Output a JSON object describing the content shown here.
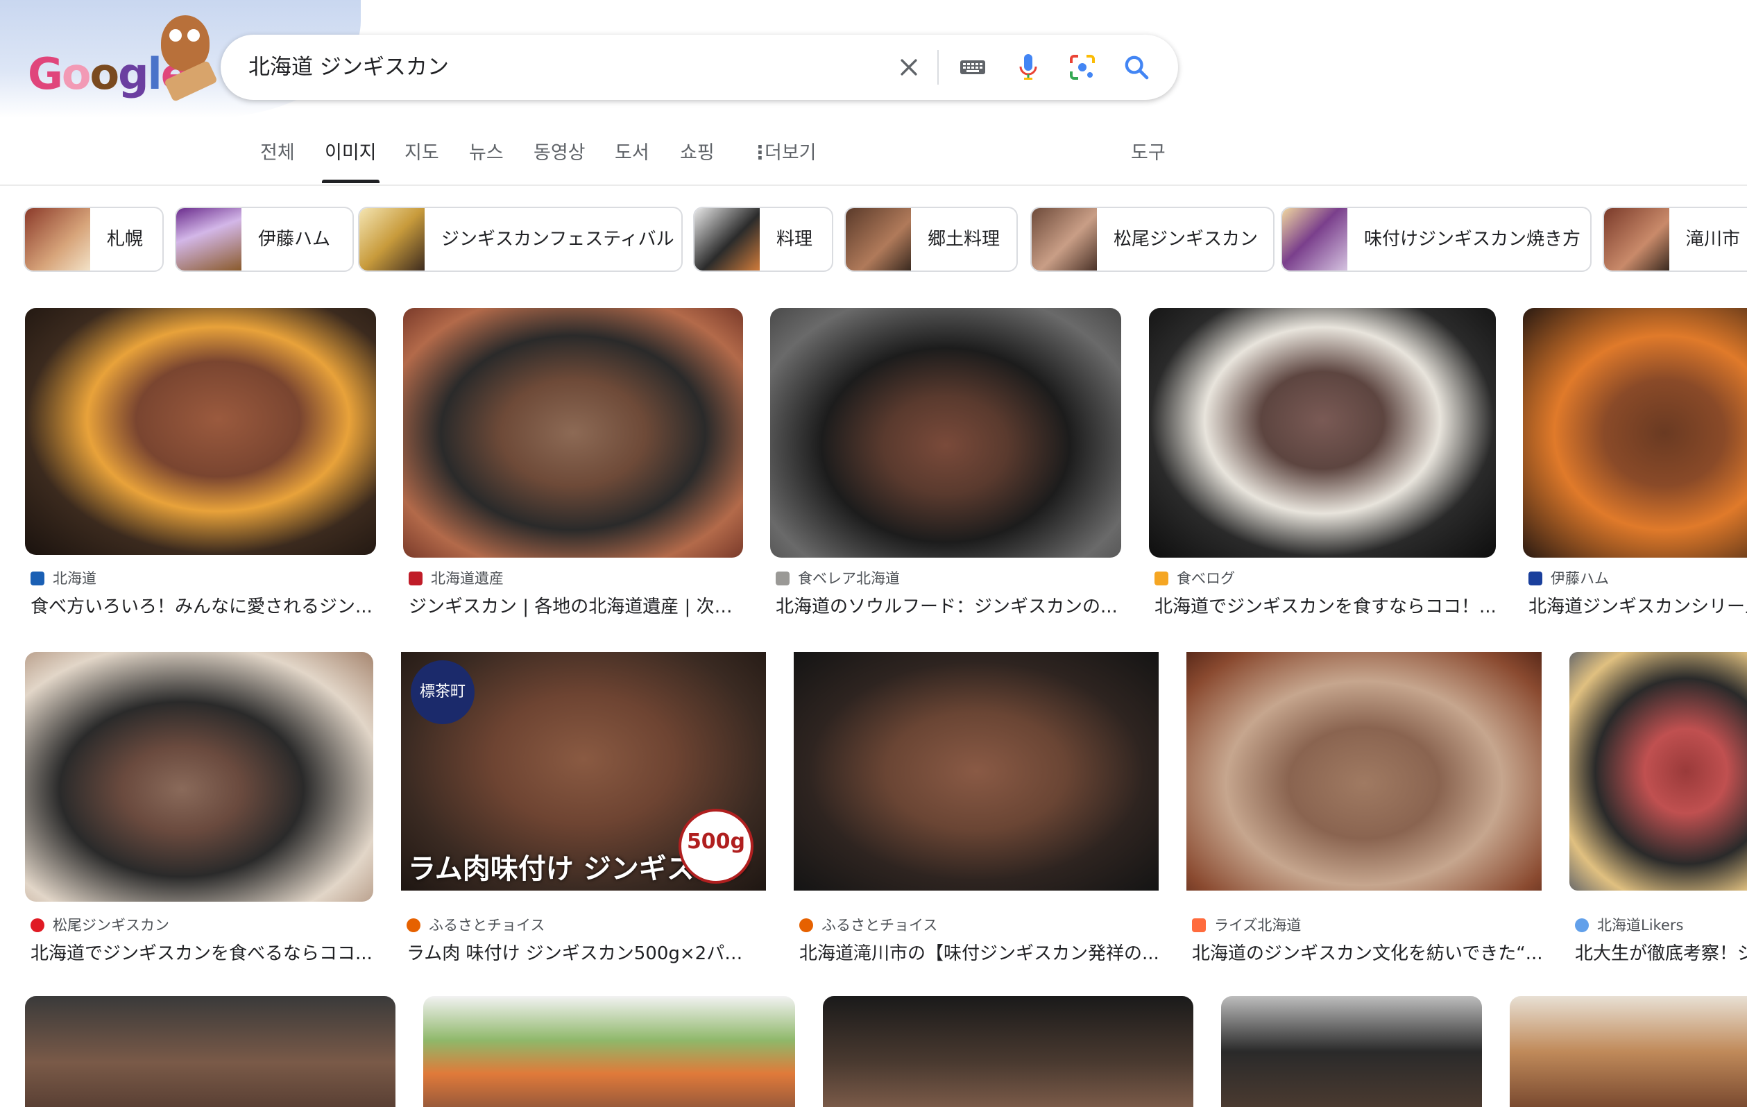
{
  "doodle": {
    "logo_letters": [
      "G",
      "o",
      "o",
      "g",
      "l",
      "e"
    ]
  },
  "search": {
    "query": "北海道 ジンギスカン",
    "icons": [
      "clear-icon",
      "keyboard-icon",
      "microphone-icon",
      "lens-icon",
      "search-icon"
    ]
  },
  "tabs": [
    {
      "label": "전체"
    },
    {
      "label": "이미지"
    },
    {
      "label": "지도"
    },
    {
      "label": "뉴스"
    },
    {
      "label": "동영상"
    },
    {
      "label": "도서"
    },
    {
      "label": "쇼핑"
    },
    {
      "label": "더보기"
    },
    {
      "label": "도구"
    }
  ],
  "chips": [
    {
      "label": "札幌"
    },
    {
      "label": "伊藤ハム"
    },
    {
      "label": "ジンギスカンフェスティバル"
    },
    {
      "label": "料理"
    },
    {
      "label": "郷土料理"
    },
    {
      "label": "松尾ジンギスカン"
    },
    {
      "label": "味付けジンギスカン焼き方"
    },
    {
      "label": "滝川市"
    }
  ],
  "results": [
    {
      "source": "北海道",
      "title": "食べ方いろいろ！みんなに愛されるジン...",
      "favicon_color": "#1a5fb4"
    },
    {
      "source": "北海道遺産",
      "title": "ジンギスカン | 各地の北海道遺産 | 次の...",
      "favicon_color": "#c01c28"
    },
    {
      "source": "食ベレア北海道",
      "title": "北海道のソウルフード：ジンギスカンの...",
      "favicon_color": "#9a9996"
    },
    {
      "source": "食べログ",
      "title": "北海道でジンギスカンを食すならココ！...",
      "favicon_color": "#f5a623"
    },
    {
      "source": "伊藤ハム",
      "title": "北海道ジンギスカンシリーズ",
      "favicon_color": "#1a3f9c"
    },
    {
      "source": "松尾ジンギスカン",
      "title": "北海道でジンギスカンを食べるならココ...",
      "favicon_color": "#e01b24"
    },
    {
      "source": "ふるさとチョイス",
      "title": "ラム肉 味付け ジンギスカン500g×2パッ...",
      "favicon_color": "#e66100"
    },
    {
      "source": "ふるさとチョイス",
      "title": "北海道滝川市の【味付ジンギスカン発祥の...",
      "favicon_color": "#e66100"
    },
    {
      "source": "ライズ北海道",
      "title": "北海道のジンギスカン文化を紡いできた“...",
      "favicon_color": "#ff6b3d"
    },
    {
      "source": "北海道Likers",
      "title": "北大生が徹底考察！ジ",
      "favicon_color": "#62a0ea"
    }
  ],
  "image_text": {
    "stamp": "標茶町",
    "overlay": "ラム肉味付け ジンギスカン",
    "badge": "500g"
  }
}
